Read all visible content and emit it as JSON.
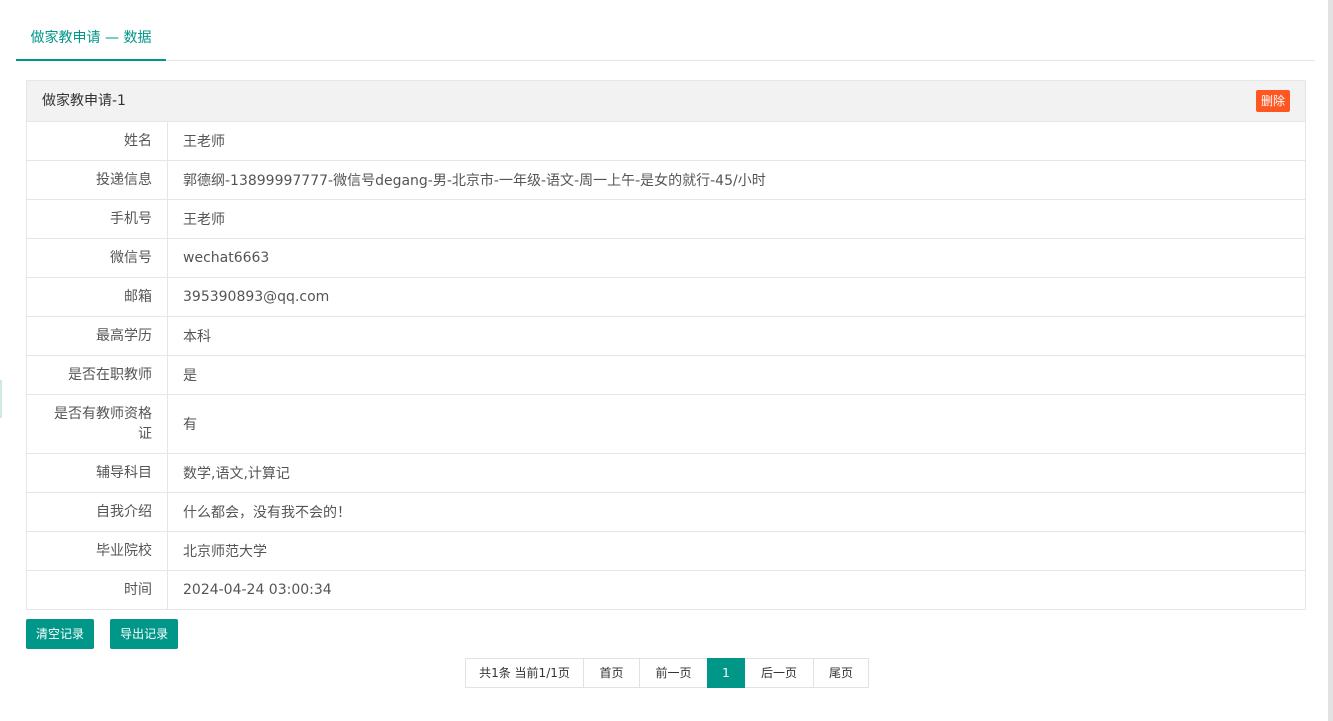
{
  "tab": {
    "label": "做家教申请 — 数据"
  },
  "record": {
    "title": "做家教申请-1",
    "delete_label": "删除",
    "fields": [
      {
        "label": "姓名",
        "value": "王老师"
      },
      {
        "label": "投递信息",
        "value": "郭德纲-13899997777-微信号degang-男-北京市-一年级-语文-周一上午-是女的就行-45/小时"
      },
      {
        "label": "手机号",
        "value": "王老师"
      },
      {
        "label": "微信号",
        "value": "wechat6663"
      },
      {
        "label": "邮箱",
        "value": "395390893@qq.com"
      },
      {
        "label": "最高学历",
        "value": "本科"
      },
      {
        "label": "是否在职教师",
        "value": "是"
      },
      {
        "label": "是否有教师资格证",
        "value": "有"
      },
      {
        "label": "辅导科目",
        "value": "数学,语文,计算记"
      },
      {
        "label": "自我介绍",
        "value": "什么都会，没有我不会的！"
      },
      {
        "label": "毕业院校",
        "value": "北京师范大学"
      },
      {
        "label": "时间",
        "value": "2024-04-24 03:00:34"
      }
    ]
  },
  "actions": {
    "clear_label": "清空记录",
    "export_label": "导出记录"
  },
  "pagination": {
    "summary": "共1条 当前1/1页",
    "first": "首页",
    "prev": "前一页",
    "current": "1",
    "next": "后一页",
    "last": "尾页"
  },
  "colors": {
    "accent": "#009688",
    "danger": "#ff5722",
    "header_bg": "#f2f2f2",
    "border": "#e6e6e6"
  }
}
